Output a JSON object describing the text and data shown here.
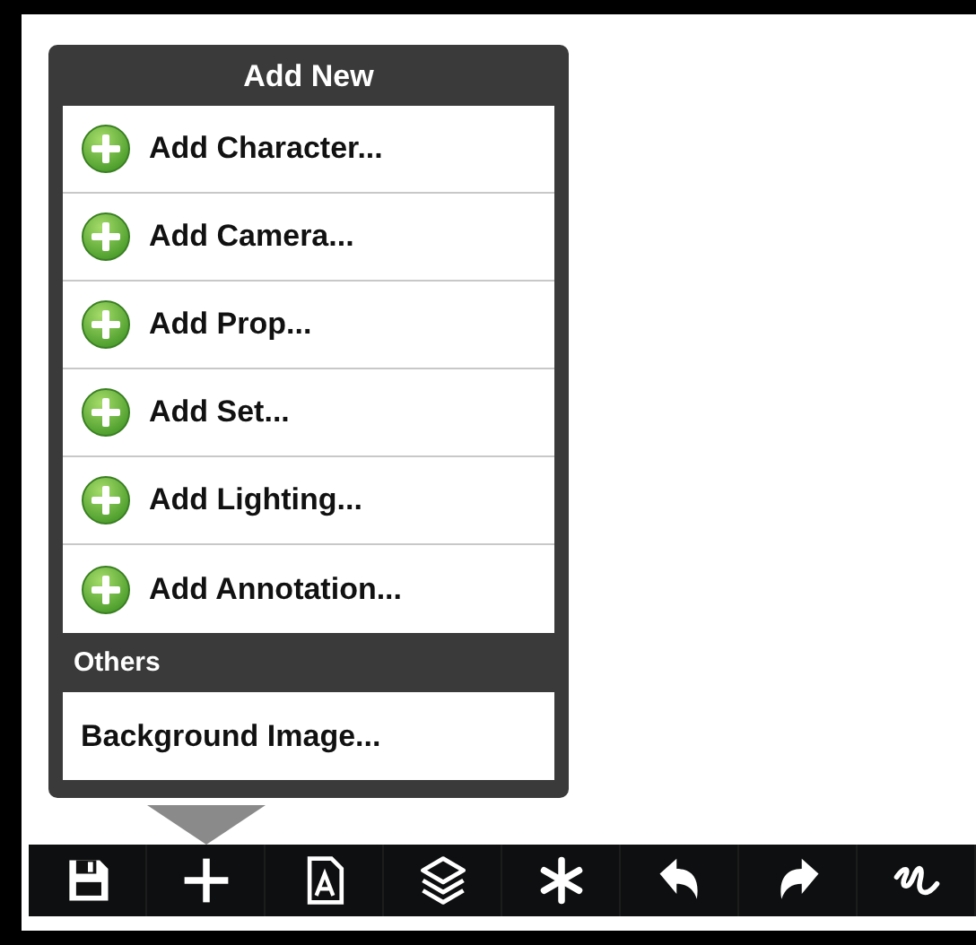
{
  "popover": {
    "title": "Add New",
    "sections": [
      {
        "items": [
          {
            "label": "Add Character...",
            "kind": "add"
          },
          {
            "label": "Add Camera...",
            "kind": "add"
          },
          {
            "label": "Add Prop...",
            "kind": "add"
          },
          {
            "label": "Add Set...",
            "kind": "add"
          },
          {
            "label": "Add Lighting...",
            "kind": "add"
          },
          {
            "label": "Add Annotation...",
            "kind": "add"
          }
        ]
      },
      {
        "heading": "Others",
        "items": [
          {
            "label": "Background Image...",
            "kind": "plain"
          }
        ]
      }
    ]
  },
  "toolbar": [
    {
      "kind": "save",
      "selected": false
    },
    {
      "kind": "add",
      "selected": true
    },
    {
      "kind": "text",
      "selected": false
    },
    {
      "kind": "layers",
      "selected": false
    },
    {
      "kind": "asterisk",
      "selected": false
    },
    {
      "kind": "undo",
      "selected": false
    },
    {
      "kind": "redo",
      "selected": false
    },
    {
      "kind": "squiggle",
      "selected": false
    }
  ]
}
